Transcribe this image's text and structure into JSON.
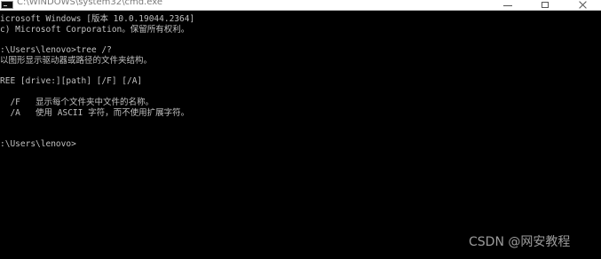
{
  "window": {
    "title": "C:\\WINDOWS\\system32\\cmd.exe"
  },
  "console": {
    "lines": [
      "icrosoft Windows [版本 10.0.19044.2364]",
      "c) Microsoft Corporation。保留所有权利。",
      "",
      ":\\Users\\lenovo>tree /?",
      "以图形显示驱动器或路径的文件夹结构。",
      "",
      "REE [drive:][path] [/F] [/A]",
      "",
      "  /F   显示每个文件夹中文件的名称。",
      "  /A   使用 ASCII 字符，而不使用扩展字符。",
      "",
      "",
      ":\\Users\\lenovo>"
    ]
  },
  "watermark": {
    "text": "CSDN @网安教程"
  },
  "colors": {
    "console_background": "#000000",
    "console_text": "#c0c0c0",
    "titlebar_background": "#ffffff"
  }
}
